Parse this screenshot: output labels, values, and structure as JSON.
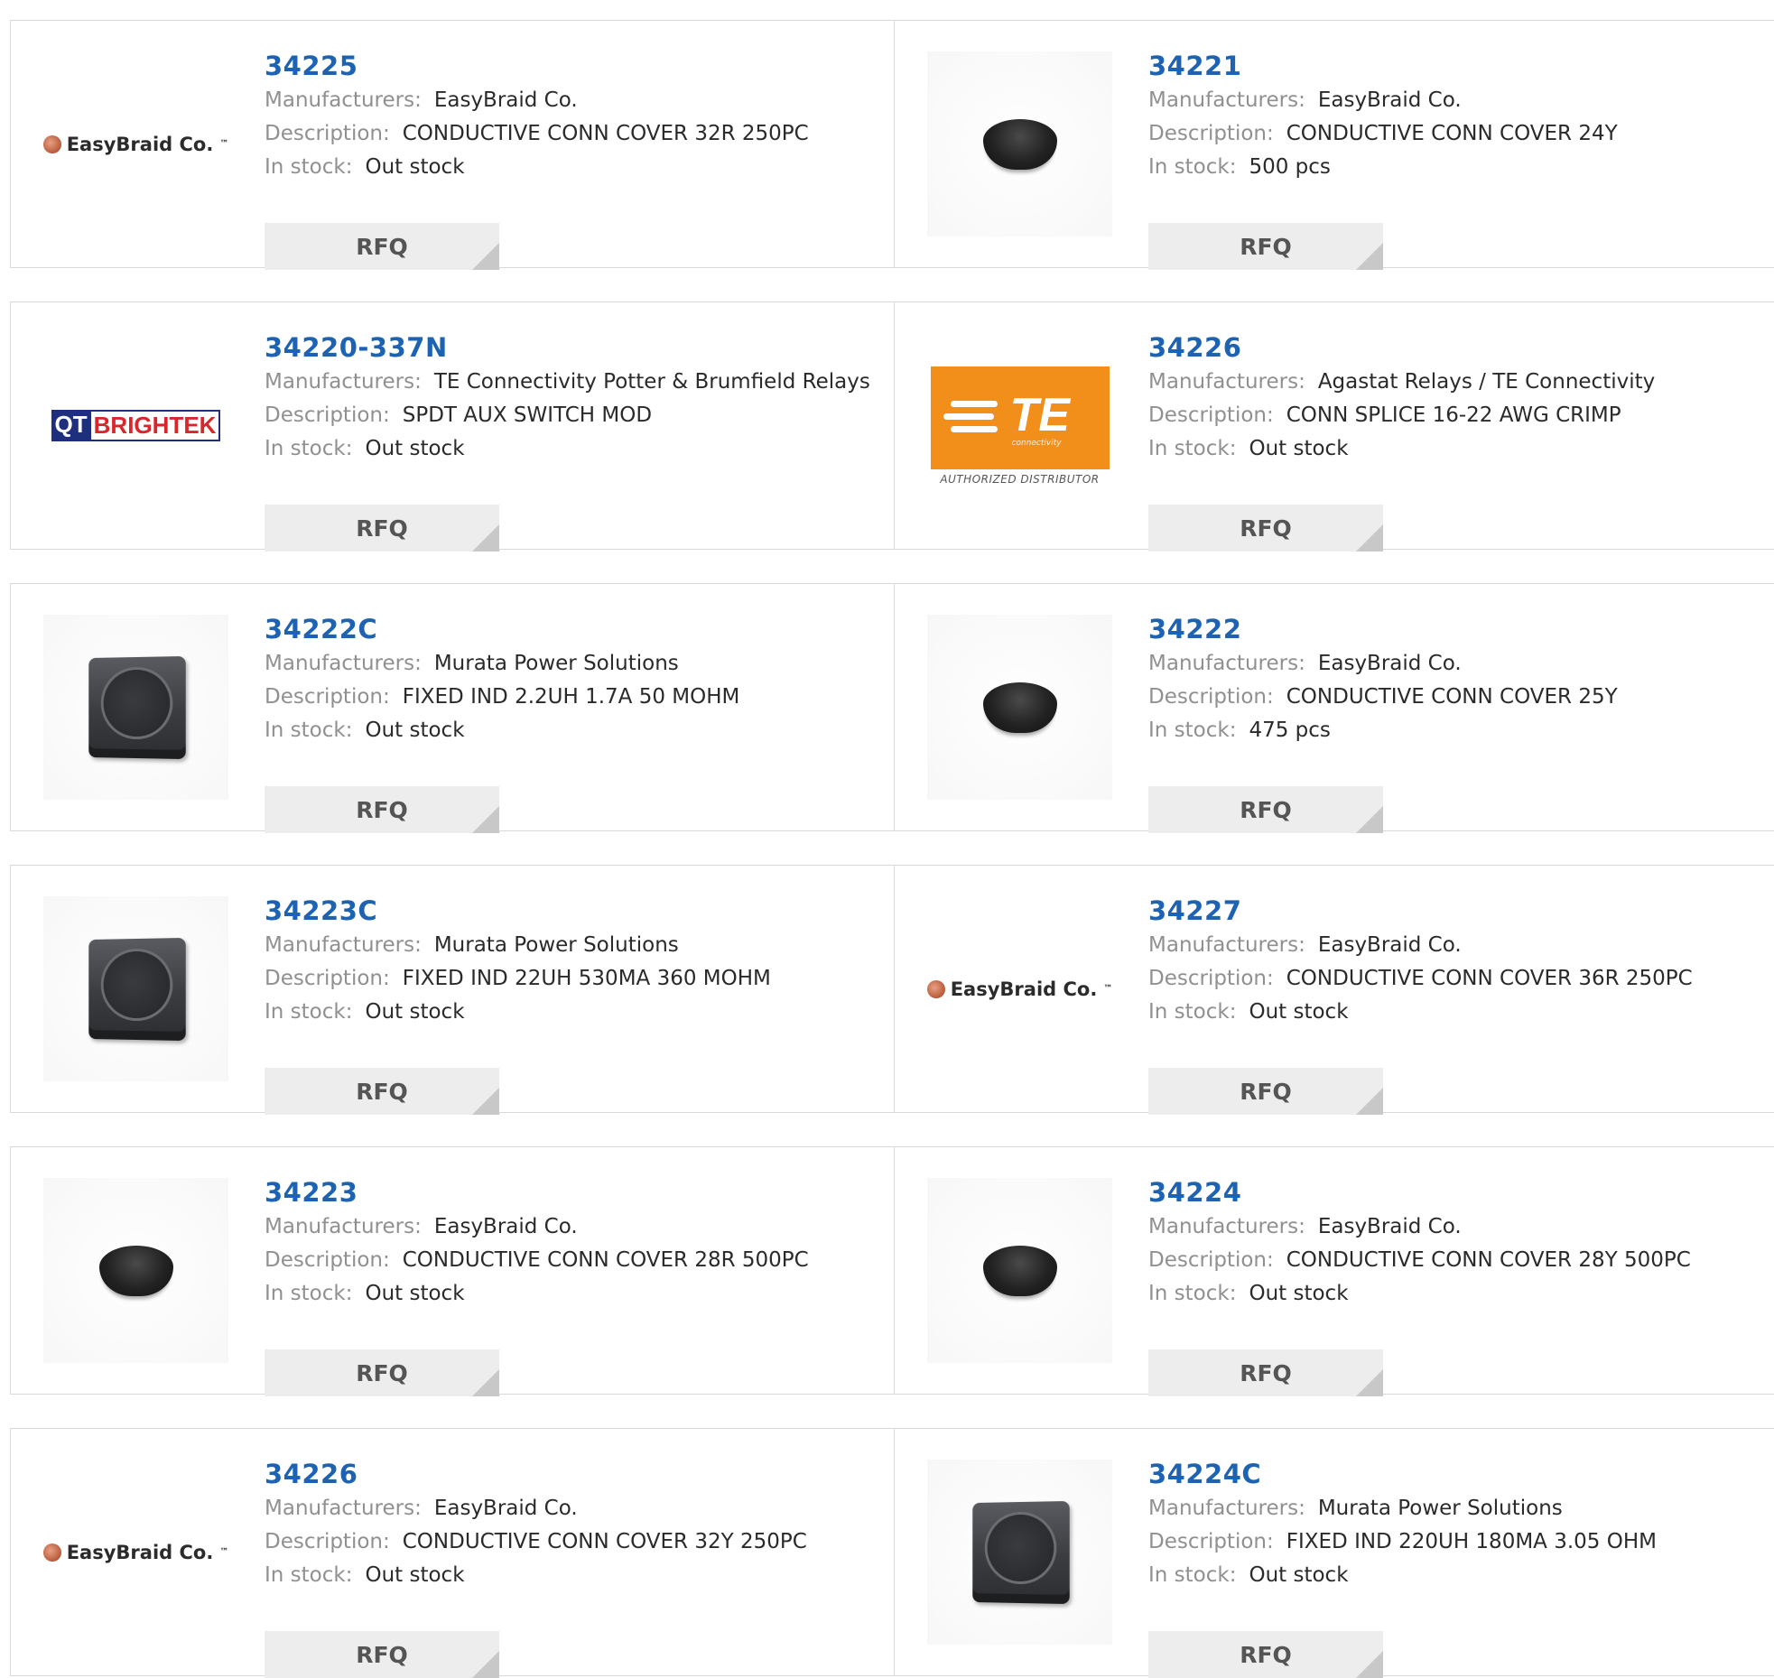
{
  "labels": {
    "manufacturer": "Manufacturers:",
    "description": "Description:",
    "stock": "In stock:",
    "rfq": "RFQ"
  },
  "colors": {
    "part_link": "#1e63b1",
    "label": "#909090",
    "rfq_bg": "#ededed",
    "border": "#d9d9d9"
  },
  "products": [
    {
      "part": "34225",
      "manufacturer": "EasyBraid Co.",
      "description": "CONDUCTIVE CONN COVER 32R 250PC",
      "stock": "Out stock",
      "image": "easybraid-logo"
    },
    {
      "part": "34221",
      "manufacturer": "EasyBraid Co.",
      "description": "CONDUCTIVE CONN COVER 24Y",
      "stock": "500 pcs",
      "image": "black-cap"
    },
    {
      "part": "34220-337N",
      "manufacturer": "TE Connectivity Potter & Brumfield Relays",
      "description": "SPDT AUX SWITCH MOD",
      "stock": "Out stock",
      "image": "qtbrightek-logo",
      "logo_text": [
        "QT",
        "BRIGHTEK"
      ]
    },
    {
      "part": "34226",
      "manufacturer": "Agastat Relays / TE Connectivity",
      "description": "CONN SPLICE 16-22 AWG CRIMP",
      "stock": "Out stock",
      "image": "te-connectivity-logo",
      "logo_text": [
        "TE",
        "connectivity",
        "AUTHORIZED DISTRIBUTOR"
      ]
    },
    {
      "part": "34222C",
      "manufacturer": "Murata Power Solutions",
      "description": "FIXED IND 2.2UH 1.7A 50 MOHM",
      "stock": "Out stock",
      "image": "inductor"
    },
    {
      "part": "34222",
      "manufacturer": "EasyBraid Co.",
      "description": "CONDUCTIVE CONN COVER 25Y",
      "stock": "475 pcs",
      "image": "black-cap"
    },
    {
      "part": "34223C",
      "manufacturer": "Murata Power Solutions",
      "description": "FIXED IND 22UH 530MA 360 MOHM",
      "stock": "Out stock",
      "image": "inductor"
    },
    {
      "part": "34227",
      "manufacturer": "EasyBraid Co.",
      "description": "CONDUCTIVE CONN COVER 36R 250PC",
      "stock": "Out stock",
      "image": "easybraid-logo"
    },
    {
      "part": "34223",
      "manufacturer": "EasyBraid Co.",
      "description": "CONDUCTIVE CONN COVER 28R 500PC",
      "stock": "Out stock",
      "image": "black-cap"
    },
    {
      "part": "34224",
      "manufacturer": "EasyBraid Co.",
      "description": "CONDUCTIVE CONN COVER 28Y 500PC",
      "stock": "Out stock",
      "image": "black-cap"
    },
    {
      "part": "34226",
      "manufacturer": "EasyBraid Co.",
      "description": "CONDUCTIVE CONN COVER 32Y 250PC",
      "stock": "Out stock",
      "image": "easybraid-logo"
    },
    {
      "part": "34224C",
      "manufacturer": "Murata Power Solutions",
      "description": "FIXED IND 220UH 180MA 3.05 OHM",
      "stock": "Out stock",
      "image": "inductor"
    }
  ],
  "logo_wordmarks": {
    "easybraid": "EasyBraid Co.",
    "easybraid_tm": "™"
  }
}
